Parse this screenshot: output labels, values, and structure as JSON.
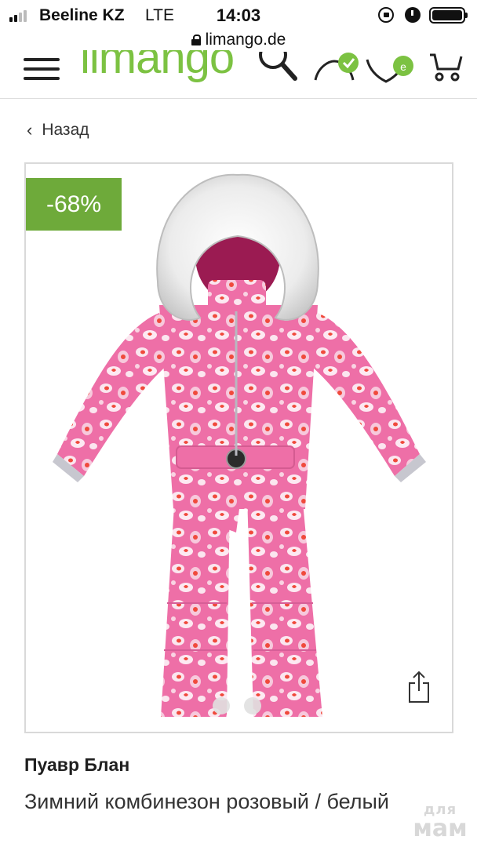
{
  "status_bar": {
    "carrier": "Beeline KZ",
    "network": "LTE",
    "time": "14:03"
  },
  "browser": {
    "url": "limango.de"
  },
  "header": {
    "logo": "limango",
    "icons": [
      "menu-icon",
      "search-icon",
      "account-icon",
      "wishlist-icon",
      "cart-icon"
    ],
    "wishlist_badge": "e"
  },
  "navigation": {
    "back_label": "Назад"
  },
  "product": {
    "discount": "-68%",
    "brand": "Пуавр Блан",
    "title": "Зимний комбинезон розовый / белый",
    "image_dots": 2,
    "active_dot": 0
  },
  "watermark": {
    "line1": "для",
    "line2": "мам"
  },
  "colors": {
    "brand_green": "#7cc242",
    "badge_green": "#6eaa3a",
    "suit_pink": "#ee6fa7"
  }
}
